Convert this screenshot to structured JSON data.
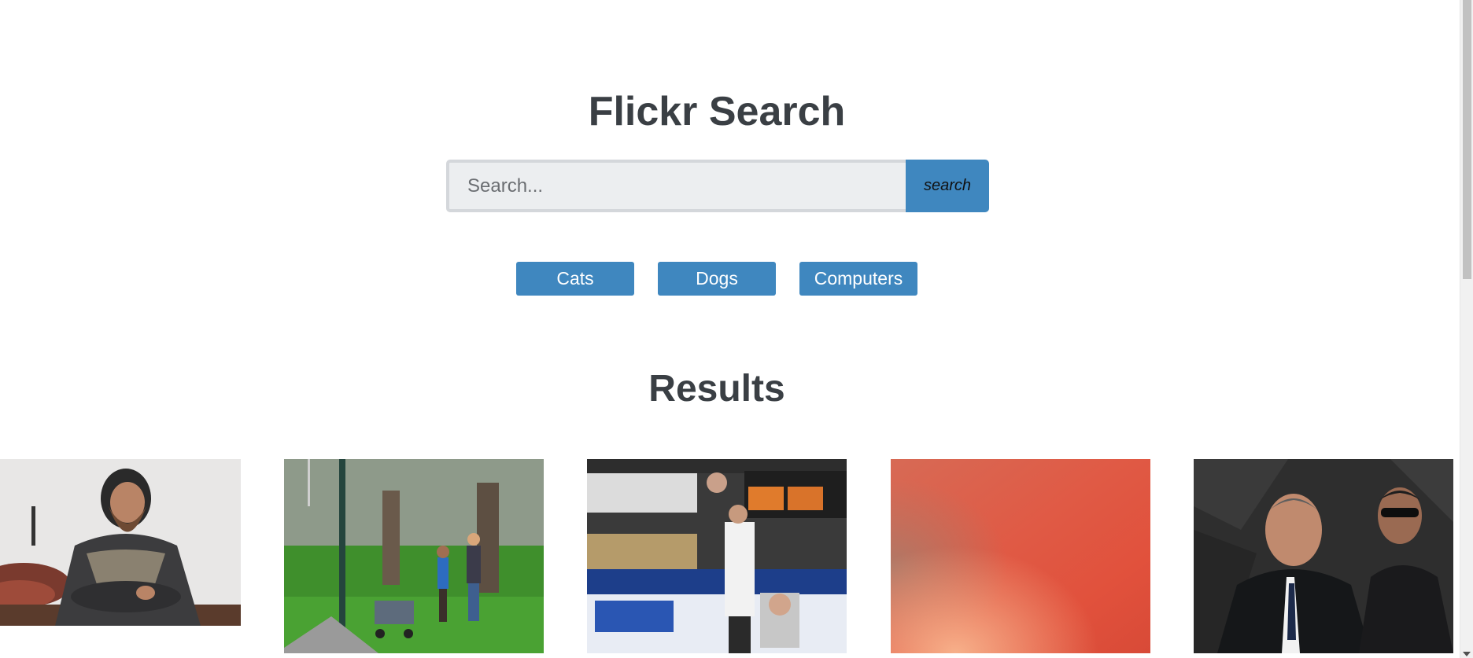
{
  "header": {
    "title": "Flickr Search"
  },
  "search": {
    "placeholder": "Search...",
    "value": "",
    "button_label": "search"
  },
  "quick_searches": [
    {
      "label": "Cats"
    },
    {
      "label": "Dogs"
    },
    {
      "label": "Computers"
    }
  ],
  "results": {
    "title": "Results",
    "images": [
      {
        "subject": "bearded man in dark clothing seated against a white wall"
      },
      {
        "subject": "couple with stroller walking in a green park"
      },
      {
        "subject": "man at a market stall with election posters"
      },
      {
        "subject": "blurred red-orange gradient"
      },
      {
        "subject": "man in dark suit with security guard in sunglasses"
      }
    ]
  },
  "colors": {
    "accent": "#3f87bf",
    "text": "#3a3f44",
    "input_background": "#eceef0"
  }
}
